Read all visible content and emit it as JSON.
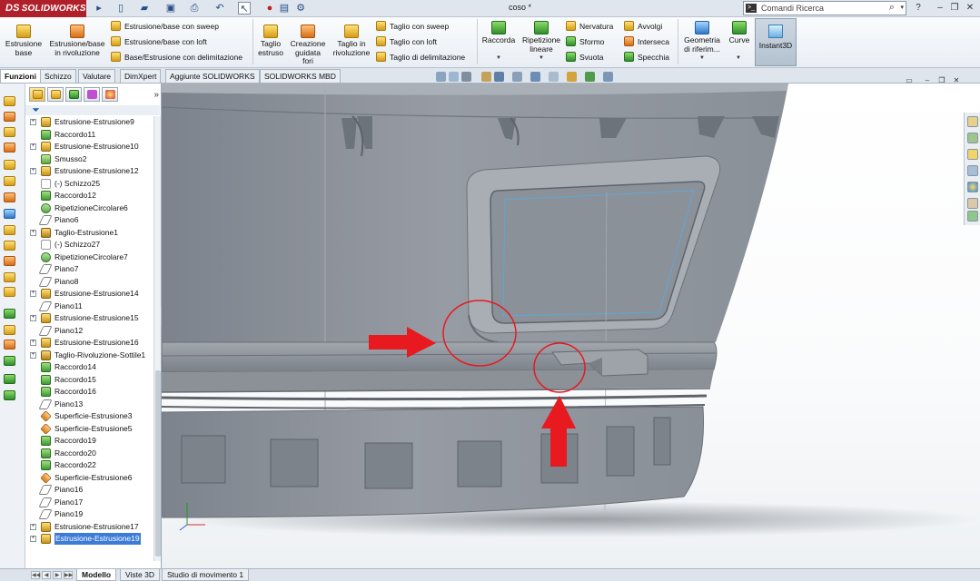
{
  "app": {
    "logo_text": "SOLIDWORKS",
    "logo_prefix": "DS",
    "doc_title": "coso *",
    "search_placeholder": "Comandi Ricerca",
    "search_terminal_glyph": ">_",
    "help_label": "?"
  },
  "ribbon": {
    "big_buttons": [
      {
        "label1": "Estrusione",
        "label2": "base"
      },
      {
        "label1": "Estrusione/base",
        "label2": "in rivoluzione"
      },
      {
        "label1": "Taglio",
        "label2": "estruso"
      },
      {
        "label1": "Creazione",
        "label2": "guidata",
        "label3": "fori"
      },
      {
        "label1": "Taglio in",
        "label2": "rivoluzione"
      },
      {
        "label1": "Raccorda",
        "label2": ""
      },
      {
        "label1": "Ripetizione",
        "label2": "lineare"
      },
      {
        "label1": "Geometria",
        "label2": "di riferim..."
      },
      {
        "label1": "Curve",
        "label2": ""
      }
    ],
    "small_group_1": [
      "Estrusione/base con sweep",
      "Estrusione/base con loft",
      "Base/Estrusione con delimitazione"
    ],
    "small_group_2": [
      "Taglio con sweep",
      "Taglio con loft",
      "Taglio di delimitazione"
    ],
    "small_group_3": [
      "Nervatura",
      "Sformo",
      "Svuota"
    ],
    "small_group_4": [
      "Avvolgi",
      "Interseca",
      "Specchia"
    ],
    "instant3d_label": "Instant3D"
  },
  "command_tabs": [
    "Funzioni",
    "Schizzo",
    "Valutare",
    "DimXpert",
    "Aggiunte SOLIDWORKS",
    "SOLIDWORKS MBD"
  ],
  "feature_tree": [
    {
      "label": "Estrusione-Estrusione9",
      "icon": "extrude-icon",
      "expandable": true
    },
    {
      "label": "Raccordo11",
      "icon": "fillet-icon",
      "expandable": false
    },
    {
      "label": "Estrusione-Estrusione10",
      "icon": "extrude-icon",
      "expandable": true
    },
    {
      "label": "Smusso2",
      "icon": "chamfer-icon",
      "expandable": false
    },
    {
      "label": "Estrusione-Estrusione12",
      "icon": "extrude-icon",
      "expandable": true
    },
    {
      "label": "(-) Schizzo25",
      "icon": "sketch-icon",
      "expandable": false
    },
    {
      "label": "Raccordo12",
      "icon": "fillet-icon",
      "expandable": false
    },
    {
      "label": "RipetizioneCircolare6",
      "icon": "circular-pattern-icon",
      "expandable": false
    },
    {
      "label": "Piano6",
      "icon": "plane-icon",
      "expandable": false
    },
    {
      "label": "Taglio-Estrusione1",
      "icon": "cut-extrude-icon",
      "expandable": true
    },
    {
      "label": "(-) Schizzo27",
      "icon": "sketch-icon",
      "expandable": false
    },
    {
      "label": "RipetizioneCircolare7",
      "icon": "circular-pattern-icon",
      "expandable": false
    },
    {
      "label": "Piano7",
      "icon": "plane-icon",
      "expandable": false
    },
    {
      "label": "Piano8",
      "icon": "plane-icon",
      "expandable": false
    },
    {
      "label": "Estrusione-Estrusione14",
      "icon": "extrude-icon",
      "expandable": true
    },
    {
      "label": "Piano11",
      "icon": "plane-icon",
      "expandable": false
    },
    {
      "label": "Estrusione-Estrusione15",
      "icon": "extrude-icon",
      "expandable": true
    },
    {
      "label": "Piano12",
      "icon": "plane-icon",
      "expandable": false
    },
    {
      "label": "Estrusione-Estrusione16",
      "icon": "extrude-icon",
      "expandable": true
    },
    {
      "label": "Taglio-Rivoluzione-Sottile1",
      "icon": "cut-revolve-icon",
      "expandable": true
    },
    {
      "label": "Raccordo14",
      "icon": "fillet-icon",
      "expandable": false
    },
    {
      "label": "Raccordo15",
      "icon": "fillet-icon",
      "expandable": false
    },
    {
      "label": "Raccordo16",
      "icon": "fillet-icon",
      "expandable": false
    },
    {
      "label": "Piano13",
      "icon": "plane-icon",
      "expandable": false
    },
    {
      "label": "Superficie-Estrusione3",
      "icon": "surface-extrude-icon",
      "expandable": false
    },
    {
      "label": "Superficie-Estrusione5",
      "icon": "surface-extrude-icon",
      "expandable": false
    },
    {
      "label": "Raccordo19",
      "icon": "fillet-icon",
      "expandable": false
    },
    {
      "label": "Raccordo20",
      "icon": "fillet-icon",
      "expandable": false
    },
    {
      "label": "Raccordo22",
      "icon": "fillet-icon",
      "expandable": false
    },
    {
      "label": "Superficie-Estrusione6",
      "icon": "surface-extrude-icon",
      "expandable": false
    },
    {
      "label": "Piano16",
      "icon": "plane-icon",
      "expandable": false
    },
    {
      "label": "Piano17",
      "icon": "plane-icon",
      "expandable": false
    },
    {
      "label": "Piano19",
      "icon": "plane-icon",
      "expandable": false
    },
    {
      "label": "Estrusione-Estrusione17",
      "icon": "extrude-icon",
      "expandable": true
    },
    {
      "label": "Estrusione-Estrusione19",
      "icon": "extrude-icon",
      "expandable": true,
      "selected": true
    }
  ],
  "bottom_tabs": [
    "Modello",
    "Viste 3D",
    "Studio di movimento 1"
  ],
  "colors": {
    "model_fill": "#8e949c",
    "annotation_red": "#e8191f",
    "selection_blue": "#3d7bd9",
    "logo_red": "#b0202a"
  }
}
